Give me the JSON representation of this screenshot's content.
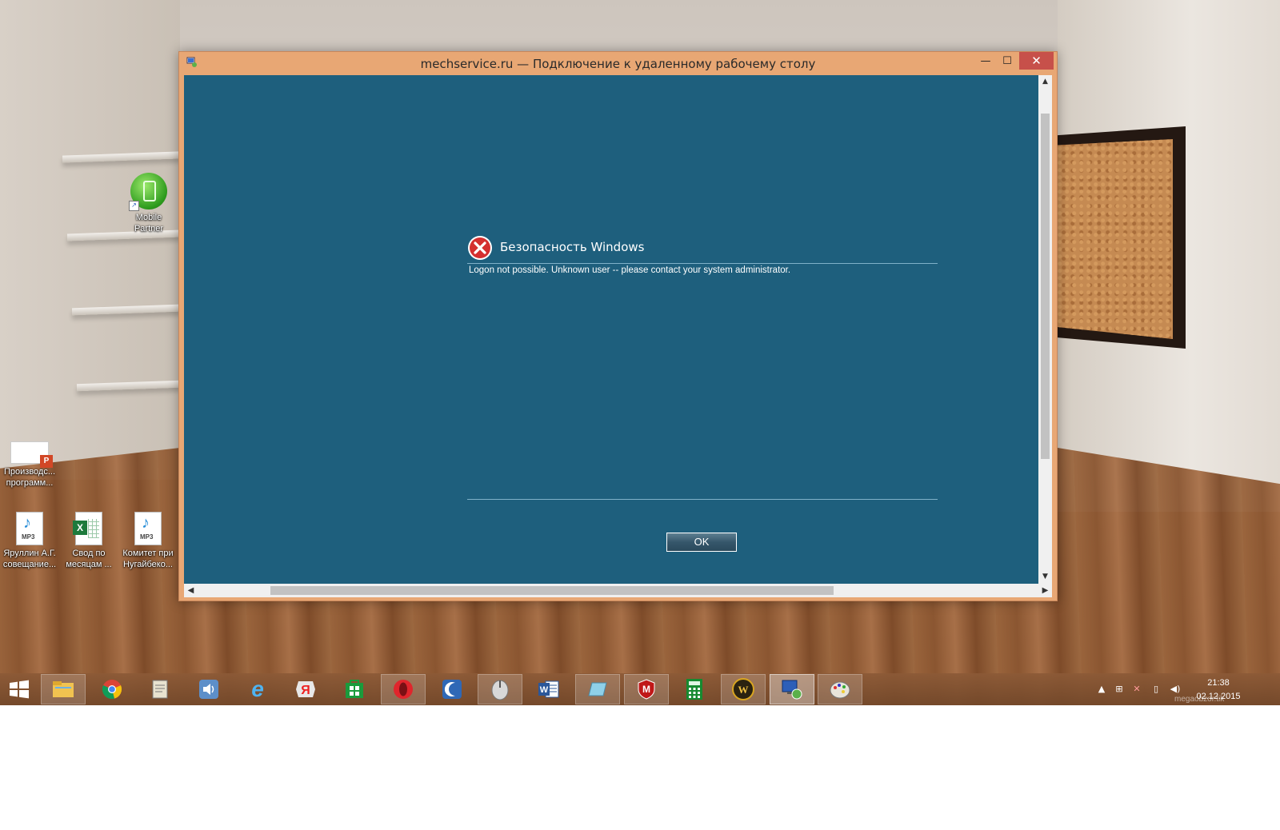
{
  "window": {
    "title": "mechservice.ru — Подключение к удаленному рабочему столу",
    "minimize_glyph": "—",
    "maximize_glyph": "☐",
    "close_glyph": "✕"
  },
  "dialog": {
    "title": "Безопасность Windows",
    "message": "Logon not possible. Unknown user -- please contact your system administrator.",
    "ok_label": "OK"
  },
  "desktop_icons": [
    {
      "label": "Mobile\nPartner",
      "icon": "mobile-partner-icon"
    },
    {
      "label": "Производс...\nпрограмм...",
      "icon": "powerpoint-file-icon"
    },
    {
      "label": "Яруллин А.Г.\nсовещание...",
      "icon": "mp3-file-icon"
    },
    {
      "label": "Свод по\nмесяцам ...",
      "icon": "excel-file-icon"
    },
    {
      "label": "Комитет при\nНугайбеко...",
      "icon": "mp3-file-icon"
    }
  ],
  "taskbar": {
    "items": [
      {
        "name": "file-explorer",
        "icon": "folder-icon",
        "state": "open"
      },
      {
        "name": "chrome",
        "icon": "chrome-icon",
        "state": "normal"
      },
      {
        "name": "notes-app",
        "icon": "notepad-icon",
        "state": "normal"
      },
      {
        "name": "audio-player",
        "icon": "speaker-icon",
        "state": "normal"
      },
      {
        "name": "internet-explorer",
        "icon": "ie-icon",
        "state": "normal"
      },
      {
        "name": "yandex-browser",
        "icon": "yandex-icon",
        "state": "normal"
      },
      {
        "name": "windows-store",
        "icon": "store-icon",
        "state": "normal"
      },
      {
        "name": "opera",
        "icon": "opera-icon",
        "state": "open"
      },
      {
        "name": "moon-app",
        "icon": "crescent-icon",
        "state": "normal"
      },
      {
        "name": "mouse-app",
        "icon": "mouse-icon",
        "state": "open"
      },
      {
        "name": "word",
        "icon": "word-icon",
        "state": "normal"
      },
      {
        "name": "eraser-app",
        "icon": "eraser-icon",
        "state": "open"
      },
      {
        "name": "mcafee",
        "icon": "mcafee-icon",
        "state": "open"
      },
      {
        "name": "calculator",
        "icon": "calculator-icon",
        "state": "normal"
      },
      {
        "name": "warcraft",
        "icon": "warcraft-icon",
        "state": "open"
      },
      {
        "name": "remote-desktop",
        "icon": "remote-desktop-icon",
        "state": "active"
      },
      {
        "name": "paint",
        "icon": "paint-icon",
        "state": "open"
      }
    ],
    "clock": {
      "time": "21:38",
      "date": "02.12.2015"
    },
    "watermark": "megaobzor.tik"
  },
  "colors": {
    "remote_bg": "#1e5f7d",
    "window_frame": "#e8a774",
    "close_button": "#c7504a"
  }
}
